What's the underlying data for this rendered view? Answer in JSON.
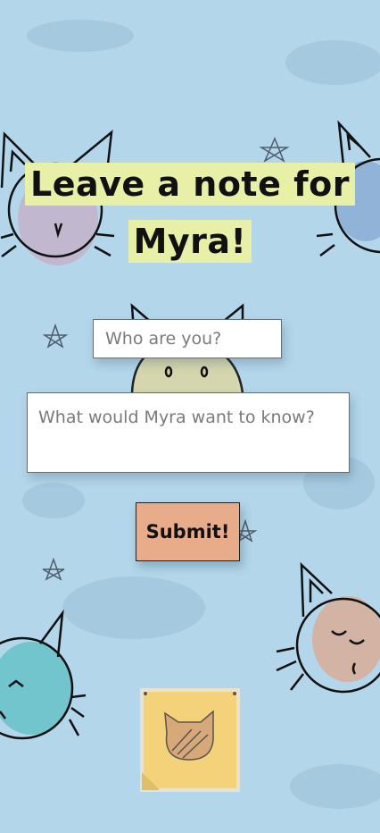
{
  "title": {
    "line1": "Leave a note for",
    "line2": "Myra!"
  },
  "form": {
    "name_placeholder": "Who are you?",
    "message_placeholder": "What would Myra want to know?",
    "submit_label": "Submit!"
  },
  "colors": {
    "background": "#b3d6ea",
    "title_highlight": "#e8f0a8",
    "submit_button": "#e9ac8a",
    "sticky_note": "#f3d27a"
  },
  "icons": [
    "cat-face-icon",
    "star-doodle-icon",
    "sticky-note-icon"
  ]
}
